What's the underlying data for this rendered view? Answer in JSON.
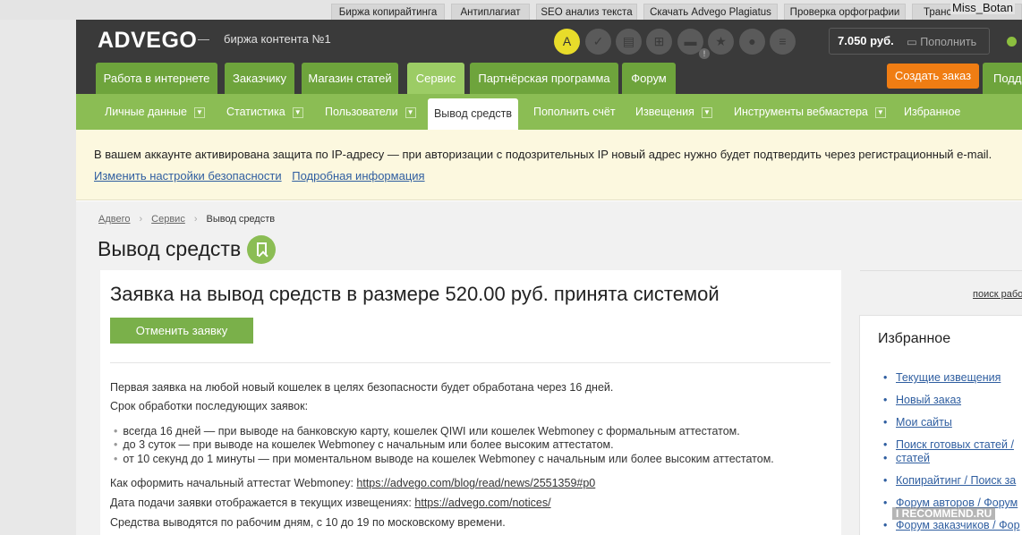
{
  "promo_tabs": [
    "Биржа копирайтинга",
    "Антиплагиат",
    "SEO анализ текста",
    "Скачать Advego Plagiatus",
    "Проверка орфографии",
    "Транс"
  ],
  "username": "Miss_Botan",
  "header": {
    "logo": "ADVEGO",
    "slogan_dash": "—",
    "slogan": "биржа контента №1",
    "icons": [
      "translate-icon",
      "check-icon",
      "document-icon",
      "cart-icon",
      "folder-icon",
      "star-icon",
      "chat-icon",
      "list-icon"
    ],
    "icon_badge": "!",
    "balance": "7.050 руб.",
    "topup_label": "Пополнить"
  },
  "main_nav": {
    "items": [
      "Работа в интернете",
      "Заказчику",
      "Магазин статей",
      "Сервис",
      "Партнёрская программа",
      "Форум"
    ],
    "active": "Сервис",
    "create_order": "Создать заказ",
    "cut_item": "Подде"
  },
  "sub_nav": {
    "items": [
      "Личные данные",
      "Статистика",
      "Пользователи",
      "Вывод средств",
      "Пополнить счёт",
      "Извещения",
      "Инструменты вебмастера",
      "Избранное"
    ],
    "active": "Вывод средств"
  },
  "notice": {
    "text": "В вашем аккаунте активирована защита по IP-адресу — при авторизации с подозрительных IP новый адрес нужно будет подтвердить через регистрационный e-mail.",
    "link1": "Изменить настройки безопасности",
    "link2": "Подробная информация"
  },
  "breadcrumb": [
    "Адвего",
    "Сервис",
    "Вывод средств"
  ],
  "page_title": "Вывод средств",
  "card": {
    "heading": "Заявка на вывод средств в размере 520.00 руб. принята системой",
    "cancel_button": "Отменить заявку",
    "line1": "Первая заявка на любой новый кошелек в целях безопасности будет обработана через 16 дней.",
    "line2": "Срок обработки последующих заявок:",
    "bullets": [
      "всегда 16 дней — при выводе на банковскую карту, кошелек QIWI или кошелек Webmoney с формальным аттестатом.",
      "до 3 суток — при выводе на кошелек Webmoney с начальным или более высоким аттестатом.",
      "от 10 секунд до 1 минуты — при моментальном выводе на кошелек Webmoney с начальным или более высоким аттестатом."
    ],
    "attest_label": "Как оформить начальный аттестат Webmoney:",
    "attest_link": "https://advego.com/blog/read/news/2551359#p0",
    "date_label": "Дата подачи заявки отображается в текущих извещениях:",
    "date_link": "https://advego.com/notices/",
    "hours": "Средства выводятся по рабочим дням, с 10 до 19 по московскому времени."
  },
  "sidebar": {
    "search_link": "поиск рабо",
    "fav_title": "Избранное",
    "fav_items": [
      "Текущие извещения",
      "Новый заказ",
      "Мои сайты",
      "Поиск готовых статей /",
      "статей",
      "Копирайтинг / Поиск за",
      "Форум авторов / Форум",
      "Форум заказчиков / Фор"
    ]
  },
  "watermark": "I RECOMMEND.RU"
}
